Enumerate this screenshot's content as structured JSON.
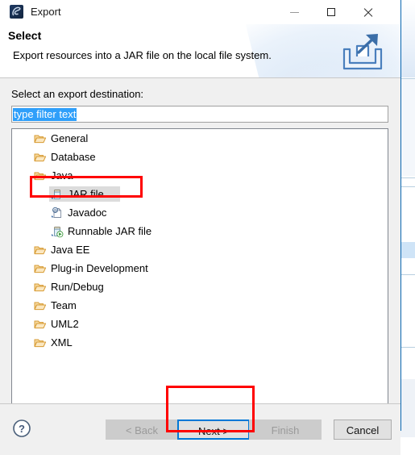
{
  "window": {
    "title": "Export",
    "app_icon": "eclipse-icon",
    "controls": {
      "minimize": "minimize-icon",
      "maximize": "maximize-icon",
      "close": "close-icon"
    }
  },
  "header": {
    "title": "Select",
    "description": "Export resources into a JAR file on the local file system.",
    "banner_icon": "export-arrow-icon"
  },
  "body": {
    "destination_label": "Select an export destination:",
    "filter": {
      "value": "type filter text",
      "placeholder": "type filter text",
      "selected": true
    },
    "tree": [
      {
        "label": "General",
        "depth": 0,
        "icon": "folder-icon",
        "selected": false
      },
      {
        "label": "Database",
        "depth": 0,
        "icon": "folder-icon",
        "selected": false
      },
      {
        "label": "Java",
        "depth": 0,
        "icon": "folder-icon",
        "selected": false
      },
      {
        "label": "JAR file",
        "depth": 1,
        "icon": "jar-icon",
        "selected": true
      },
      {
        "label": "Javadoc",
        "depth": 1,
        "icon": "javadoc-icon",
        "selected": false
      },
      {
        "label": "Runnable JAR file",
        "depth": 1,
        "icon": "runnable-jar-icon",
        "selected": false
      },
      {
        "label": "Java EE",
        "depth": 0,
        "icon": "folder-icon",
        "selected": false
      },
      {
        "label": "Plug-in Development",
        "depth": 0,
        "icon": "folder-icon",
        "selected": false
      },
      {
        "label": "Run/Debug",
        "depth": 0,
        "icon": "folder-icon",
        "selected": false
      },
      {
        "label": "Team",
        "depth": 0,
        "icon": "folder-icon",
        "selected": false
      },
      {
        "label": "UML2",
        "depth": 0,
        "icon": "folder-icon",
        "selected": false
      },
      {
        "label": "XML",
        "depth": 0,
        "icon": "folder-icon",
        "selected": false
      }
    ]
  },
  "footer": {
    "help_icon": "help-question-icon",
    "buttons": {
      "back": "< Back",
      "next": "Next >",
      "finish": "Finish",
      "cancel": "Cancel"
    }
  },
  "annotations": {
    "highlight_color": "#ff0000",
    "items": [
      "jar-file-row",
      "next-button"
    ]
  },
  "colors": {
    "focus_border": "#0078d7",
    "selection_blue": "#2f9ffa",
    "dialog_background": "#f0f0f0",
    "folder_icon": "#e8a33d",
    "dialog_border": "#0a67b1"
  }
}
